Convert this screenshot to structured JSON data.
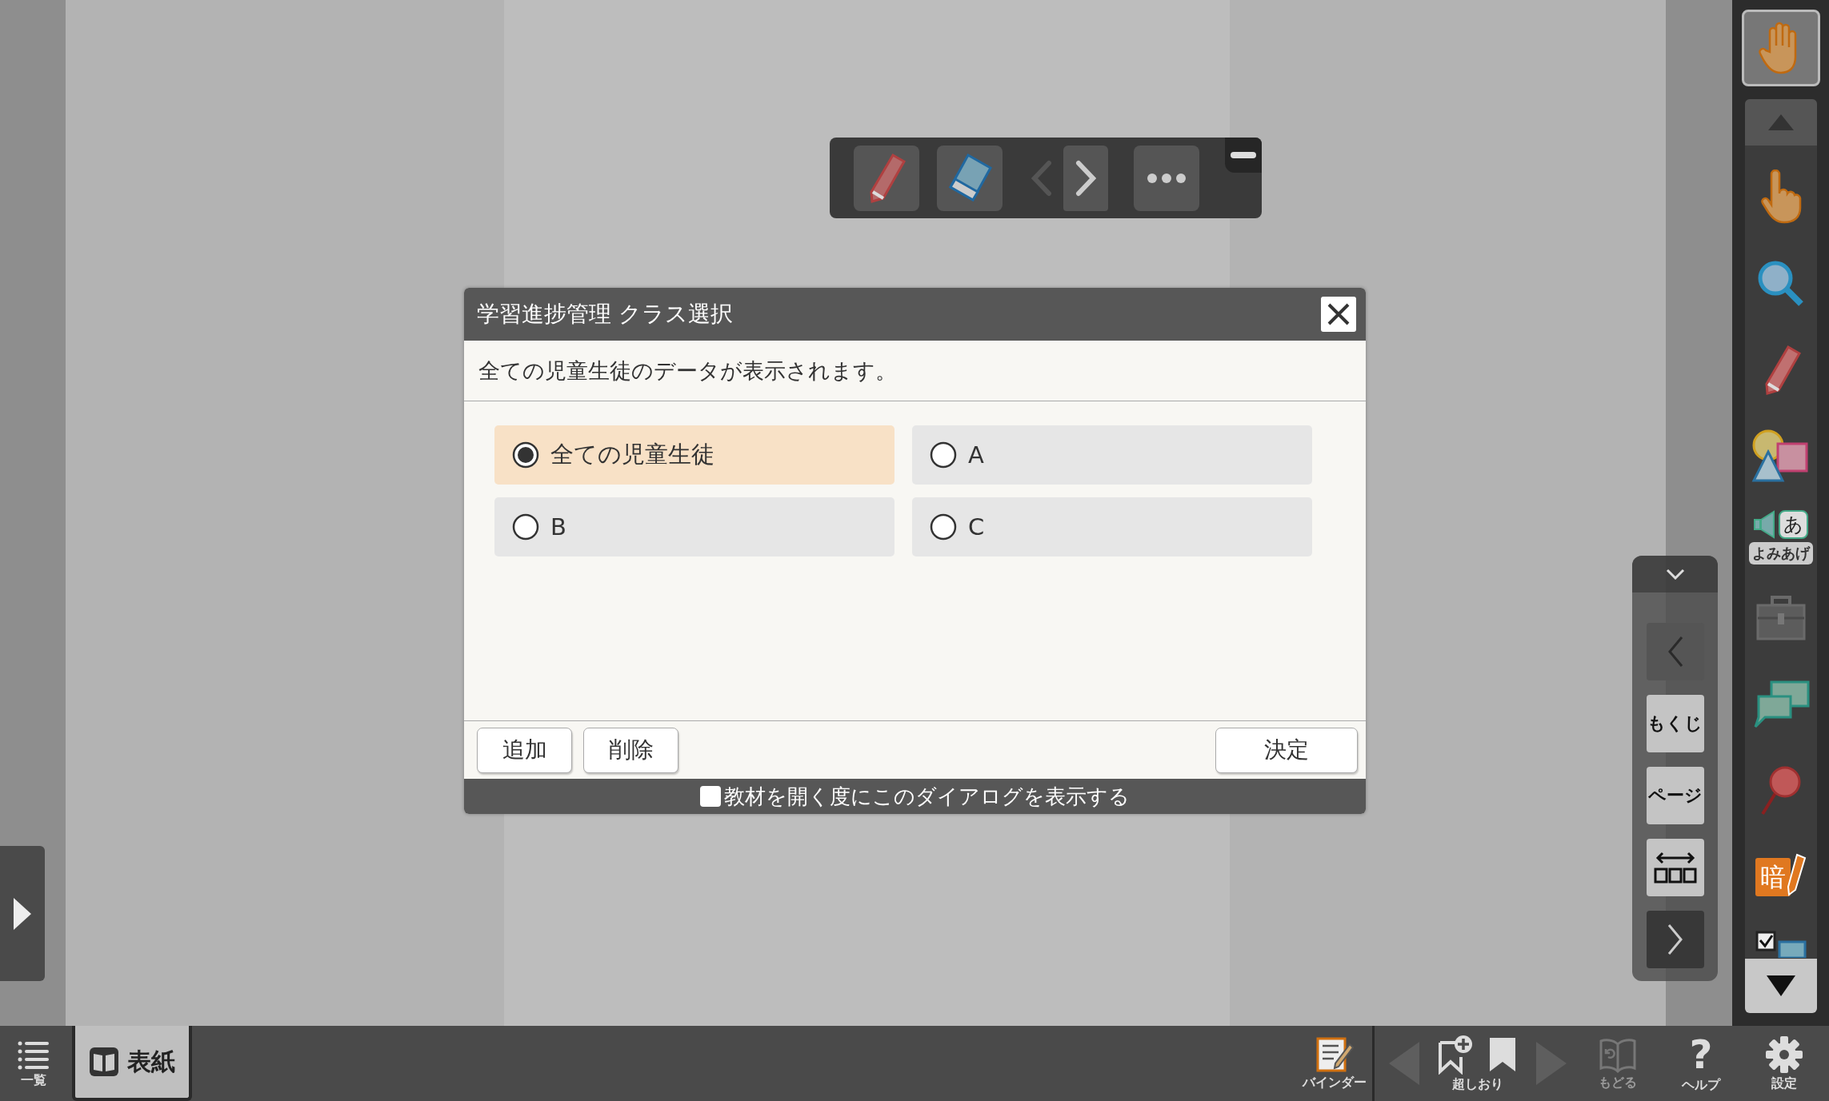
{
  "dialog": {
    "title": "学習進捗管理 クラス選択",
    "message": "全ての児童生徒のデータが表示されます。",
    "options": [
      {
        "label": "全ての児童生徒",
        "selected": true
      },
      {
        "label": "A",
        "selected": false
      },
      {
        "label": "B",
        "selected": false
      },
      {
        "label": "C",
        "selected": false
      }
    ],
    "buttons": [
      "追加",
      "削除"
    ],
    "confirm": "決定",
    "show_on_open": {
      "label": "教材を開く度にこのダイアログを表示する",
      "checked": false
    }
  },
  "side_nav": {
    "buttons": [
      "もくじ",
      "ページ"
    ]
  },
  "right_toolbar": {
    "read_aloud_glyph": "あ",
    "read_aloud_label": "よみあげ",
    "memorize_glyph": "暗"
  },
  "bottom_bar": {
    "list_label": "一覧",
    "cover_tab": "表紙",
    "binder_label": "バインダー",
    "bookmark_label": "超しおり",
    "back": {
      "label": "もどる",
      "disabled": true
    },
    "help_glyph": "?",
    "help_label": "ヘルプ",
    "settings_label": "設定"
  }
}
